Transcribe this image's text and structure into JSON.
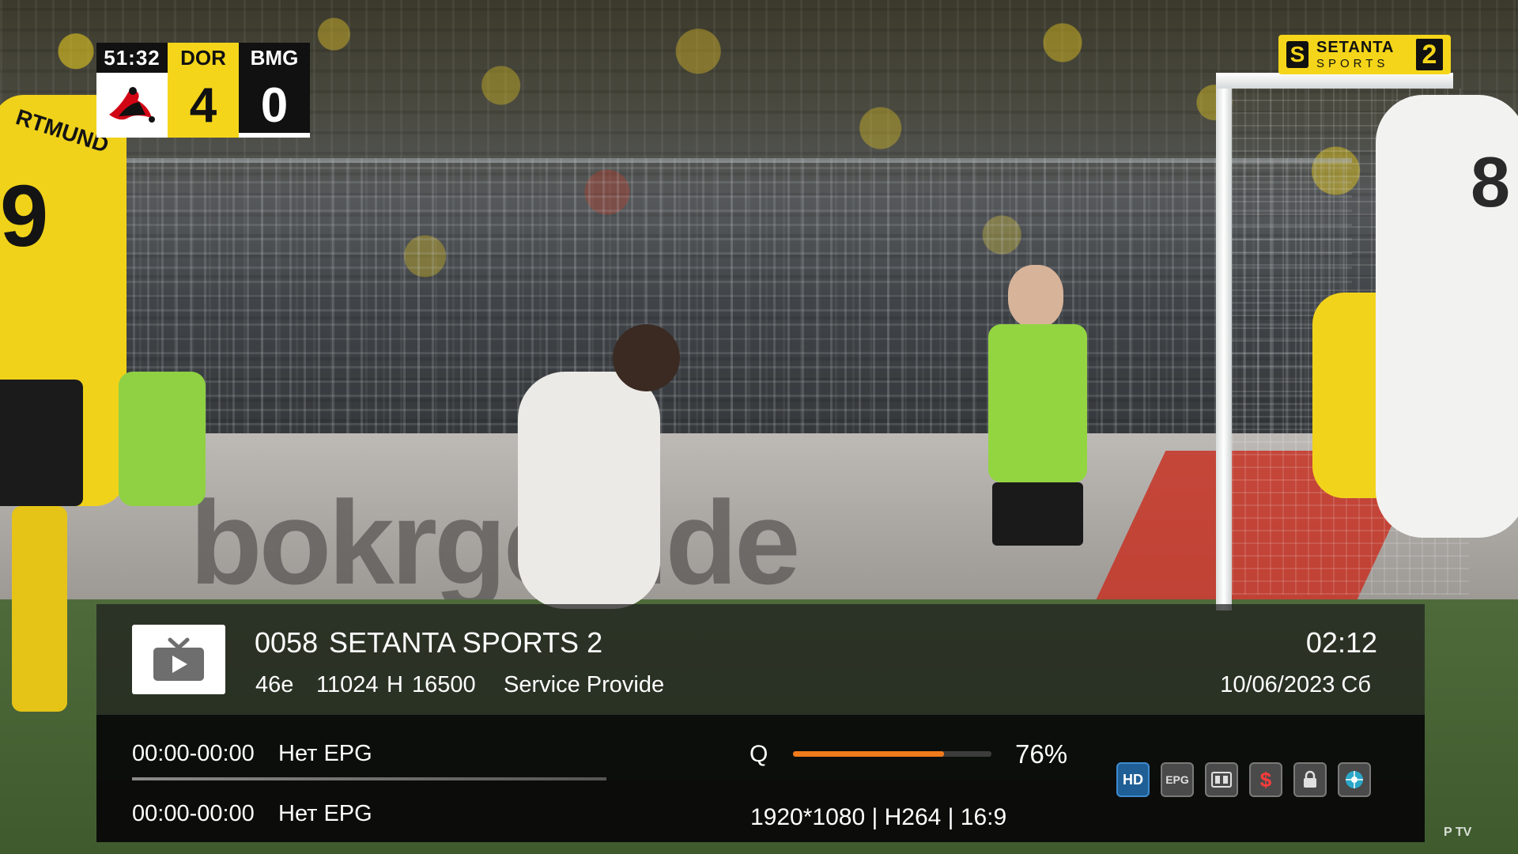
{
  "scorebug": {
    "clock": "51:32",
    "home_team": "DOR",
    "home_score": "4",
    "away_team": "BMG",
    "away_score": "0",
    "colors": {
      "home": "#f4d51a",
      "away": "#111111"
    }
  },
  "broadcaster": {
    "word1": "SETANTA",
    "word2": "SPORTS",
    "channel_digit": "2",
    "color": "#f4d51a"
  },
  "background": {
    "board_text": "bokrgen.de",
    "right_player_number": "8",
    "left_player_number": "9",
    "left_player_name": "RTMUND"
  },
  "infobar": {
    "channel_number": "0058",
    "channel_name": "SETANTA SPORTS 2",
    "satellite": "46e",
    "frequency": "11024",
    "polarization": "H",
    "symbol_rate": "16500",
    "provider": "Service Provide",
    "time": "02:12",
    "date": "10/06/2023 Сб",
    "epg": [
      {
        "time": "00:00-00:00",
        "title": "Нет EPG"
      },
      {
        "time": "00:00-00:00",
        "title": "Нет EPG"
      }
    ],
    "signal": {
      "label": "Q",
      "value_text": "76%",
      "level": 0.76,
      "bar_color": "#f07a1c"
    },
    "video_info": "1920*1080 | H264 | 16:9",
    "status_icons": {
      "hd": "HD",
      "epg": "EPG",
      "subtitles": "subtitles-icon",
      "scrambled": "$",
      "lock": "lock-icon",
      "network": "network-icon"
    }
  },
  "watermark": "P TV"
}
